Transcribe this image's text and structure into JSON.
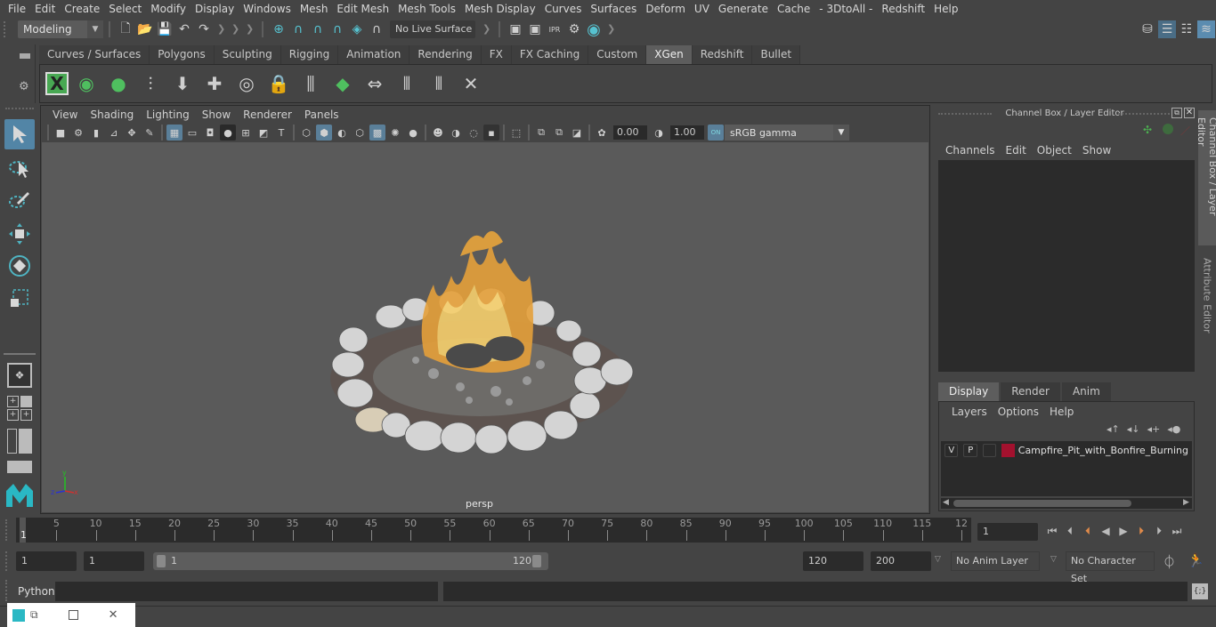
{
  "menubar": [
    "File",
    "Edit",
    "Create",
    "Select",
    "Modify",
    "Display",
    "Windows",
    "Mesh",
    "Edit Mesh",
    "Mesh Tools",
    "Mesh Display",
    "Curves",
    "Surfaces",
    "Deform",
    "UV",
    "Generate",
    "Cache",
    "- 3DtoAll -",
    "Redshift",
    "Help"
  ],
  "statusline": {
    "mode": "Modeling",
    "live_surface": "No Live Surface"
  },
  "shelf": {
    "tabs": [
      "Curves / Surfaces",
      "Polygons",
      "Sculpting",
      "Rigging",
      "Animation",
      "Rendering",
      "FX",
      "FX Caching",
      "Custom",
      "XGen",
      "Redshift",
      "Bullet"
    ],
    "active_tab": "XGen",
    "icons": [
      "xgen-window-icon",
      "xgen-preview-icon",
      "xgen-clear-preview-icon",
      "xgen-add-guide-icon",
      "xgen-place-icon",
      "xgen-add-guides-icon",
      "xgen-select-guides-icon",
      "xgen-lock-guides-icon",
      "xgen-split-guides-icon",
      "xgen-density-icon",
      "xgen-flip-guides-icon",
      "xgen-sculpt-icon",
      "xgen-bound-icon",
      "xgen-delete-guides-icon"
    ]
  },
  "viewport": {
    "menus": [
      "View",
      "Shading",
      "Lighting",
      "Show",
      "Renderer",
      "Panels"
    ],
    "exposure": "0.00",
    "gamma_value": "1.00",
    "color_space": "sRGB gamma",
    "camera_label": "persp"
  },
  "channel_box": {
    "title": "Channel Box / Layer Editor",
    "menus": [
      "Channels",
      "Edit",
      "Object",
      "Show"
    ]
  },
  "layer_editor": {
    "tabs": [
      "Display",
      "Render",
      "Anim"
    ],
    "active_tab": "Display",
    "menus": [
      "Layers",
      "Options",
      "Help"
    ],
    "layers": [
      {
        "visible": "V",
        "playback": "P",
        "color": "#a3112e",
        "name": "Campfire_Pit_with_Bonfire_Burning"
      }
    ]
  },
  "side_tabs": [
    "Channel Box / Layer Editor",
    "Attribute Editor"
  ],
  "timeline": {
    "start_label": "1",
    "ticks": [
      "5",
      "10",
      "15",
      "20",
      "25",
      "30",
      "35",
      "40",
      "45",
      "50",
      "55",
      "60",
      "65",
      "70",
      "75",
      "80",
      "85",
      "90",
      "95",
      "100",
      "105",
      "110",
      "115",
      "12"
    ],
    "current_frame": "1"
  },
  "range": {
    "start_time": "1",
    "playback_start": "1",
    "slider_start": "1",
    "slider_end": "120",
    "playback_end": "120",
    "end_time": "200",
    "anim_layer": "No Anim Layer",
    "character_set": "No Character Set"
  },
  "command_line": {
    "language": "Python"
  }
}
